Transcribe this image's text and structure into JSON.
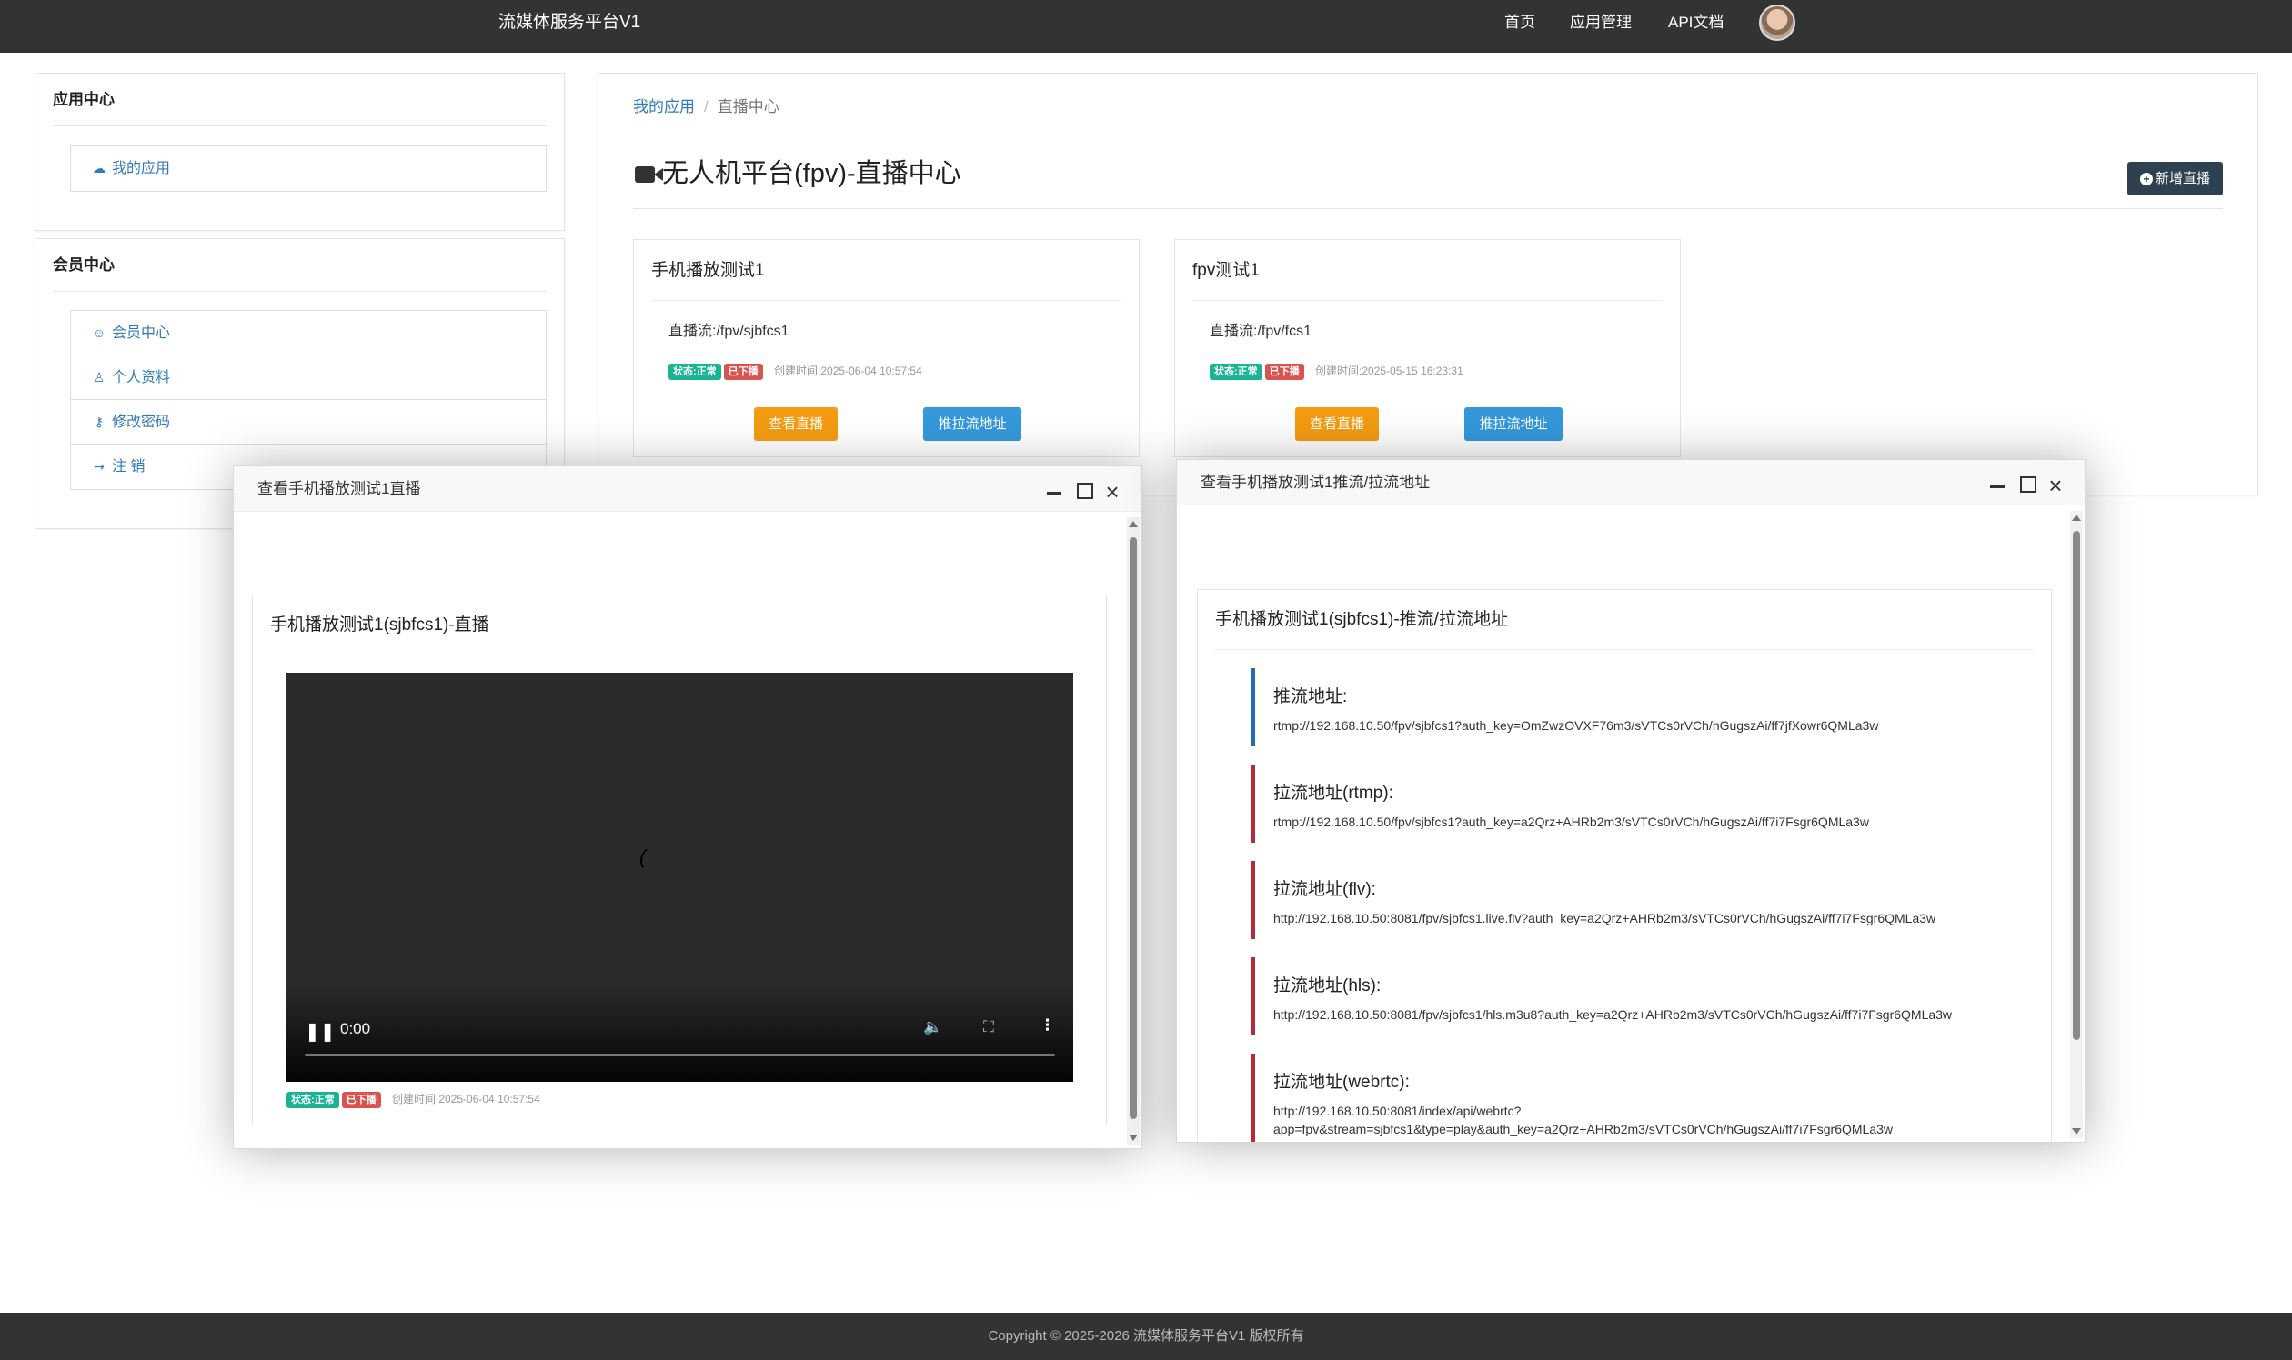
{
  "nav": {
    "brand": "流媒体服务平台V1",
    "links": [
      "首页",
      "应用管理",
      "API文档"
    ]
  },
  "sidebar": {
    "app_center": {
      "title": "应用中心",
      "items": [
        {
          "label": "我的应用",
          "icon": "cloud-icon"
        }
      ]
    },
    "member_center": {
      "title": "会员中心",
      "items": [
        {
          "label": "会员中心",
          "icon": "user-circle-icon"
        },
        {
          "label": "个人资料",
          "icon": "user-icon"
        },
        {
          "label": "修改密码",
          "icon": "key-icon"
        },
        {
          "label": "注 销",
          "icon": "signout-icon"
        }
      ]
    }
  },
  "breadcrumb": {
    "parent": "我的应用",
    "current": "直播中心"
  },
  "page": {
    "title": "无人机平台(fpv)-直播中心",
    "new_button": "新增直播"
  },
  "cards": [
    {
      "title": "手机播放测试1",
      "stream": "直播流:/fpv/sjbfcs1",
      "status": "状态:正常",
      "state": "已下播",
      "created": "创建时间:2025-06-04 10:57:54",
      "view_btn": "查看直播",
      "push_btn": "推拉流地址"
    },
    {
      "title": "fpv测试1",
      "stream": "直播流:/fpv/fcs1",
      "status": "状态:正常",
      "state": "已下播",
      "created": "创建时间:2025-05-15 16:23:31",
      "view_btn": "查看直播",
      "push_btn": "推拉流地址"
    }
  ],
  "live_dialog": {
    "title": "查看手机播放测试1直播",
    "panel_title": "手机播放测试1(sjbfcs1)-直播",
    "time": "0:00",
    "status": "状态:正常",
    "state": "已下播",
    "created": "创建时间:2025-06-04 10:57:54"
  },
  "addr_dialog": {
    "title": "查看手机播放测试1推流/拉流地址",
    "panel_title": "手机播放测试1(sjbfcs1)-推流/拉流地址",
    "items": [
      {
        "label": "推流地址:",
        "value": "rtmp://192.168.10.50/fpv/sjbfcs1?auth_key=OmZwzOVXF76m3/sVTCs0rVCh/hGugszAi/ff7jfXowr6QMLa3w"
      },
      {
        "label": "拉流地址(rtmp):",
        "value": "rtmp://192.168.10.50/fpv/sjbfcs1?auth_key=a2Qrz+AHRb2m3/sVTCs0rVCh/hGugszAi/ff7i7Fsgr6QMLa3w"
      },
      {
        "label": "拉流地址(flv):",
        "value": "http://192.168.10.50:8081/fpv/sjbfcs1.live.flv?auth_key=a2Qrz+AHRb2m3/sVTCs0rVCh/hGugszAi/ff7i7Fsgr6QMLa3w"
      },
      {
        "label": "拉流地址(hls):",
        "value": "http://192.168.10.50:8081/fpv/sjbfcs1/hls.m3u8?auth_key=a2Qrz+AHRb2m3/sVTCs0rVCh/hGugszAi/ff7i7Fsgr6QMLa3w"
      },
      {
        "label": "拉流地址(webrtc):",
        "value": "http://192.168.10.50:8081/index/api/webrtc?\napp=fpv&stream=sjbfcs1&type=play&auth_key=a2Qrz+AHRb2m3/sVTCs0rVCh/hGugszAi/ff7i7Fsgr6QMLa3w"
      }
    ]
  },
  "footer": "Copyright © 2025-2026 流媒体服务平台V1 版权所有"
}
